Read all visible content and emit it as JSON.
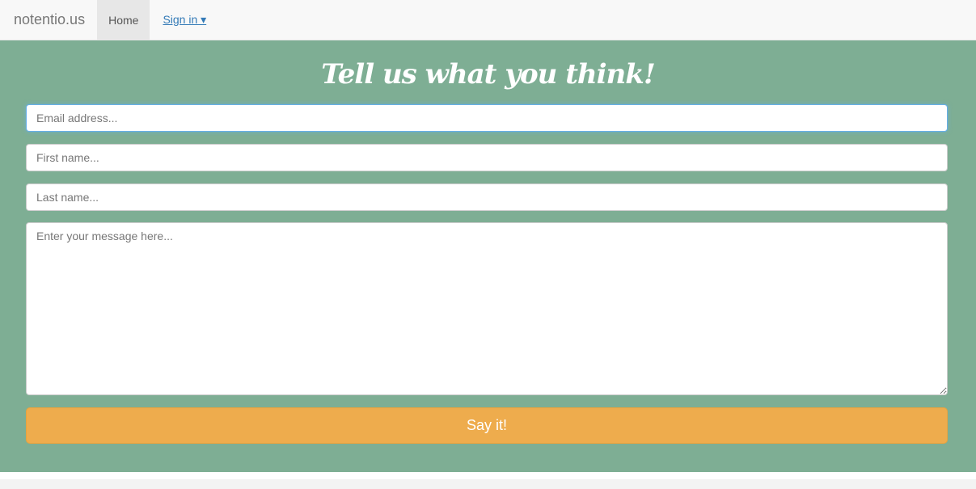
{
  "navbar": {
    "brand": "notentio.us",
    "home_label": "Home",
    "signin_label": "Sign in ▾"
  },
  "hero": {
    "title": "Tell us what you think!"
  },
  "form": {
    "email_placeholder": "Email address...",
    "first_name_placeholder": "First name...",
    "last_name_placeholder": "Last name...",
    "message_placeholder": "Enter your message here...",
    "submit_label": "Say it!"
  },
  "colors": {
    "hero_bg": "#7eae94",
    "button_bg": "#eeac4d",
    "link": "#337ab7"
  }
}
